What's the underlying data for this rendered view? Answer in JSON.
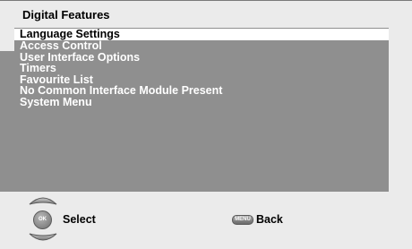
{
  "header": {
    "title": "Digital Features"
  },
  "menu": {
    "items": [
      {
        "label": "Language Settings",
        "selected": true
      },
      {
        "label": "Access Control",
        "selected": false
      },
      {
        "label": "User Interface Options",
        "selected": false
      },
      {
        "label": "Timers",
        "selected": false
      },
      {
        "label": "Favourite List",
        "selected": false
      },
      {
        "label": "No Common Interface Module Present",
        "selected": false
      },
      {
        "label": "System Menu",
        "selected": false
      }
    ]
  },
  "footer": {
    "ok_key": "OK",
    "select_label": "Select",
    "menu_key": "MENU",
    "back_label": "Back",
    "icons": [
      "nav-up-icon",
      "nav-down-icon",
      "ok-key-icon",
      "menu-key-icon"
    ]
  },
  "colors": {
    "panel": "#8f8f8f",
    "background": "#ebebeb",
    "highlight": "#ffffff"
  }
}
